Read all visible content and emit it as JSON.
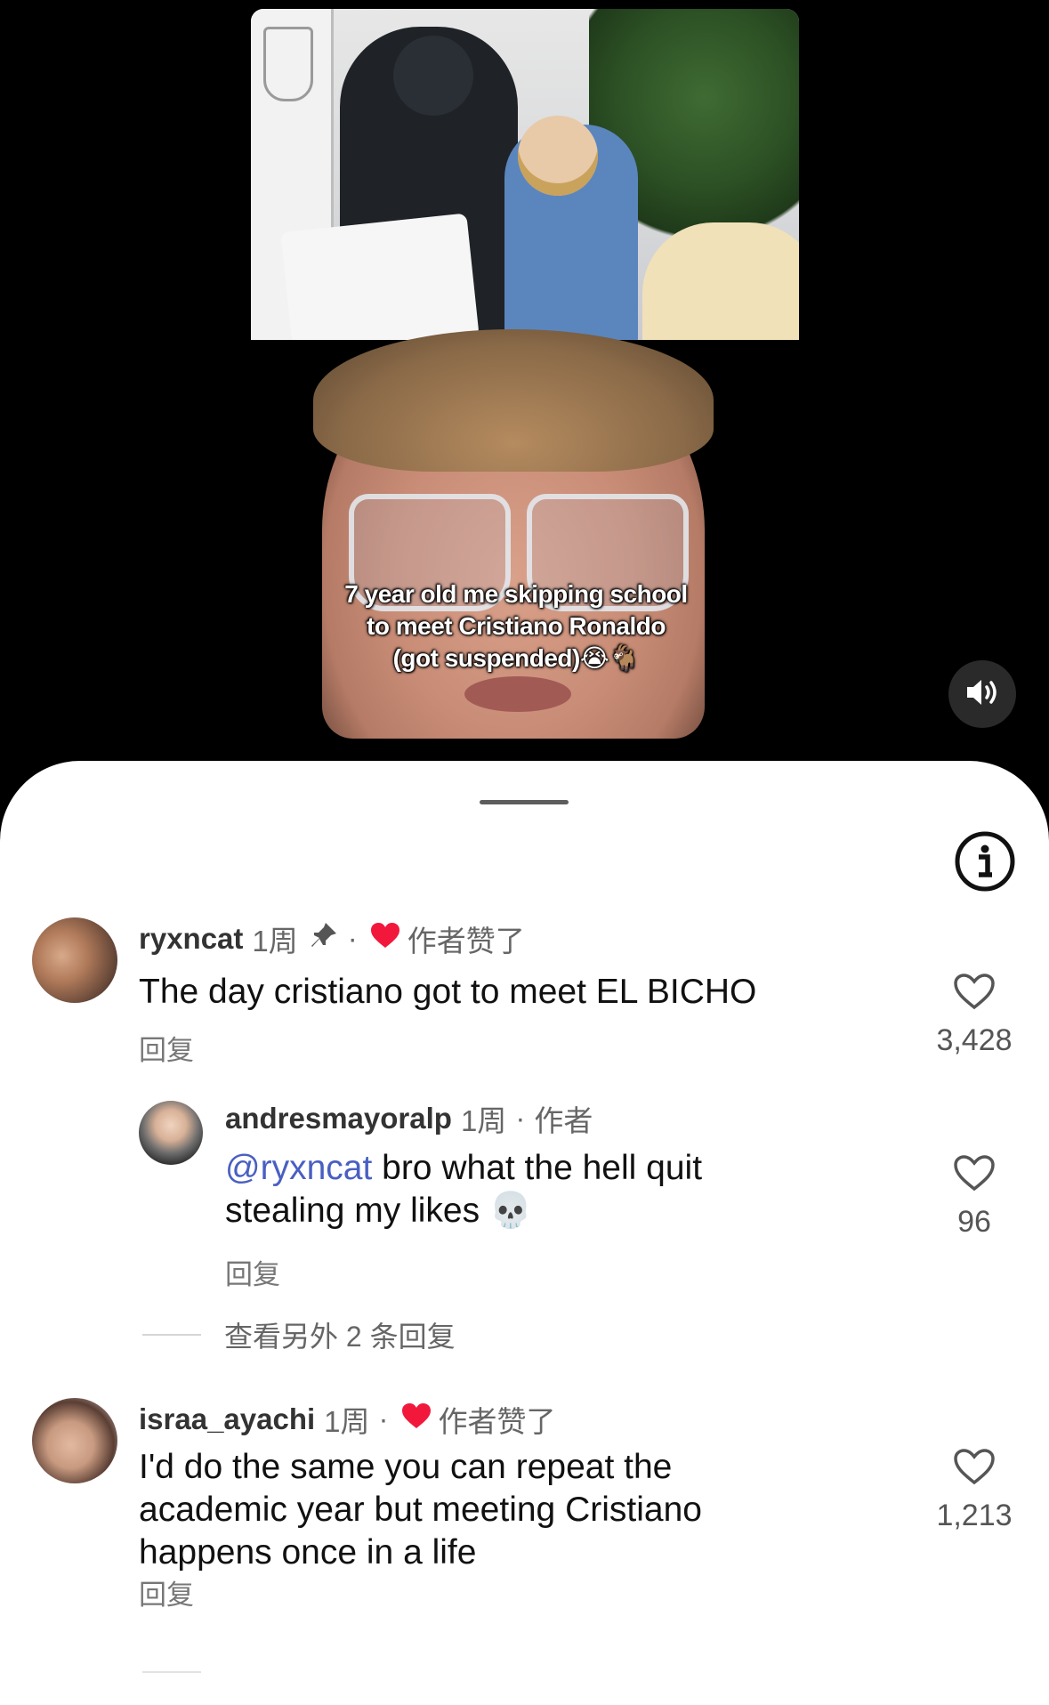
{
  "video": {
    "caption_lines": [
      "7 year old me skipping school",
      "to meet Cristiano Ronaldo",
      "(got suspended)😭🐐"
    ],
    "sound_icon": "speaker-on-icon"
  },
  "sheet": {
    "info_icon": "info-icon"
  },
  "comments": [
    {
      "username": "ryxncat",
      "time": "1周",
      "pinned_icon": "pin-icon",
      "liked_by_author": "作者赞了",
      "text": "The day cristiano got to meet EL BICHO",
      "reply_label": "回复",
      "likes": "3,428"
    },
    {
      "username": "andresmayoralp",
      "time": "1周",
      "author_tag": "作者",
      "mention": "@ryxncat",
      "text_line1_rest": " bro what the hell quit",
      "text_line2": "stealing my likes 💀",
      "reply_label": "回复",
      "likes": "96"
    },
    {
      "username": "israa_ayachi",
      "time": "1周",
      "liked_by_author": "作者赞了",
      "text_lines": [
        "I'd do the same you can repeat the",
        "academic year but meeting Cristiano",
        "happens once in a life"
      ],
      "reply_label": "回复",
      "likes": "1,213"
    }
  ],
  "view_more_replies": "查看另外 2 条回复",
  "colors": {
    "heart_red": "#f2183c",
    "mention": "#4a5fc2"
  }
}
